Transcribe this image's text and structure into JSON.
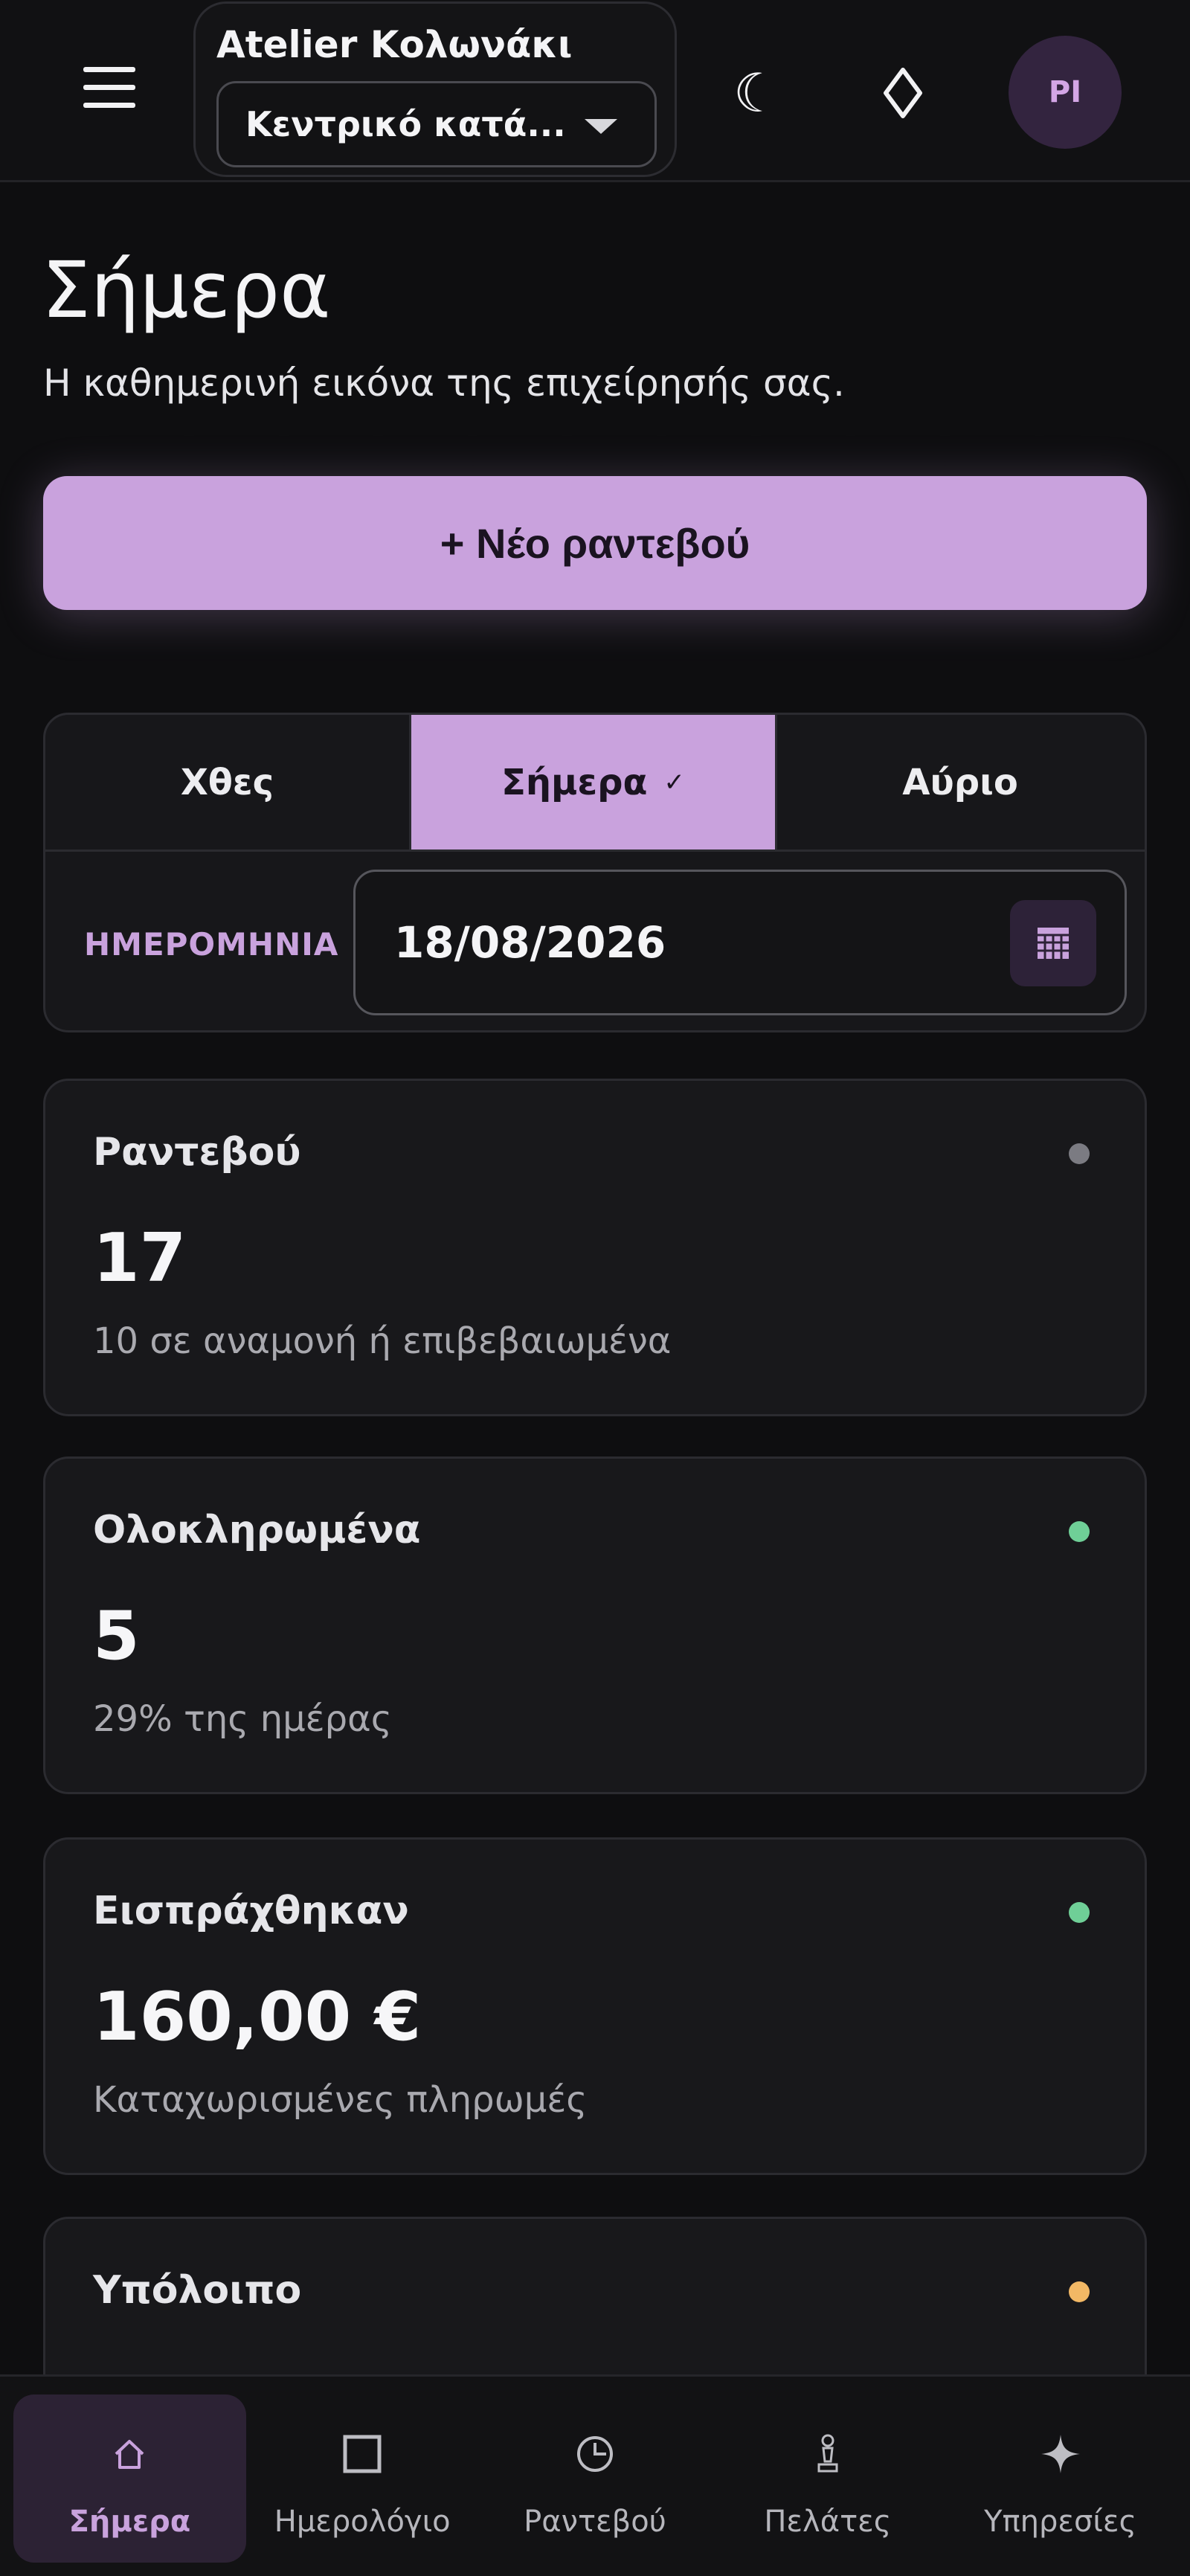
{
  "header": {
    "business_name": "Atelier Κολωνάκι",
    "branch": "Κεντρικό κατά...",
    "avatar_initials": "PI",
    "icons": [
      "menu-icon",
      "moon-icon",
      "diamond-icon"
    ]
  },
  "page": {
    "title": "Σήμερα",
    "subtitle": "Η καθημερινή εικόνα της επιχείρησής σας.",
    "new_appointment_label": "+ Νέο ραντεβού"
  },
  "date_selector": {
    "tabs": [
      {
        "label": "Χθες",
        "active": false
      },
      {
        "label": "Σήμερα",
        "active": true
      },
      {
        "label": "Αύριο",
        "active": false
      }
    ],
    "active_check": "✓",
    "date_label": "ΗΜΕΡΟΜΗΝΙΑ",
    "date_value": "18/08/2026"
  },
  "stats": [
    {
      "label": "Ραντεβού",
      "value": "17",
      "sub": "10 σε αναμονή ή επιβεβαιωμένα",
      "dot_color": "#7b7b82"
    },
    {
      "label": "Ολοκληρωμένα",
      "value": "5",
      "sub": "29% της ημέρας",
      "dot_color": "#6fcf97"
    },
    {
      "label": "Εισπράχθηκαν",
      "value": "160,00 €",
      "sub": "Καταχωρισμένες πληρωμές",
      "dot_color": "#6fcf97"
    },
    {
      "label": "Υπόλοιπο",
      "value": "",
      "sub": "",
      "dot_color": "#f2b865"
    }
  ],
  "colors": {
    "accent": "#c9a2dd",
    "background": "#0e0e10",
    "card": "#18181b"
  },
  "bottom_nav": [
    {
      "label": "Σήμερα",
      "icon": "home-icon",
      "active": true
    },
    {
      "label": "Ημερολόγιο",
      "icon": "calendar-square-icon",
      "active": false
    },
    {
      "label": "Ραντεβού",
      "icon": "clock-icon",
      "active": false
    },
    {
      "label": "Πελάτες",
      "icon": "person-icon",
      "active": false
    },
    {
      "label": "Υπηρεσίες",
      "icon": "sparkle-icon",
      "active": false
    }
  ]
}
